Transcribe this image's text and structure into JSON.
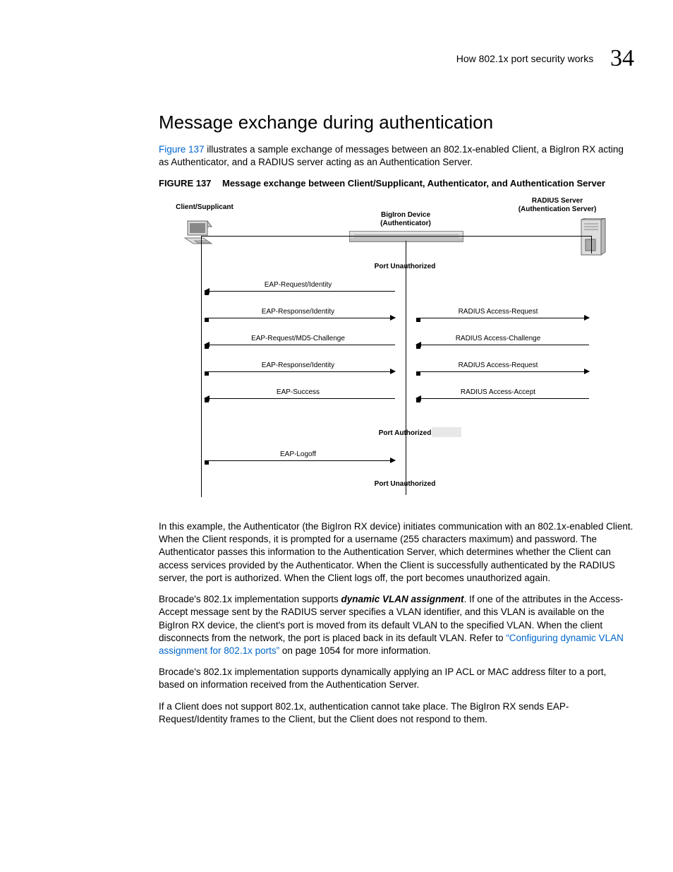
{
  "header": {
    "running_title": "How 802.1x port security works",
    "chapter_number": "34"
  },
  "section_title": "Message exchange during authentication",
  "intro": {
    "link": "Figure 137",
    "rest": " illustrates a sample exchange of messages between an 802.1x-enabled Client, a BigIron RX acting as Authenticator, and a RADIUS server acting as an Authentication Server."
  },
  "figure": {
    "label": "FIGURE 137",
    "caption": "Message exchange between Client/Supplicant, Authenticator, and Authentication Server"
  },
  "diagram": {
    "client_label": "Client/Supplicant",
    "device_label_l1": "BigIron Device",
    "device_label_l2": "(Authenticator)",
    "server_label_l1": "RADIUS Server",
    "server_label_l2": "(Authentication Server)",
    "state_unauth": "Port Unauthorized",
    "state_auth": "Port Authorized",
    "left_msgs": [
      "EAP-Request/Identity",
      "EAP-Response/Identity",
      "EAP-Request/MD5-Challenge",
      "EAP-Response/Identity",
      "EAP-Success",
      "EAP-Logoff"
    ],
    "right_msgs": [
      "RADIUS Access-Request",
      "RADIUS Access-Challenge",
      "RADIUS Access-Request",
      "RADIUS Access-Accept"
    ]
  },
  "para1": "In this example, the Authenticator (the BigIron RX device) initiates communication with an 802.1x-enabled Client. When the Client responds, it is prompted for a username (255 characters maximum) and password. The Authenticator passes this information to the Authentication Server, which determines whether the Client can access services provided by the Authenticator. When the Client is successfully authenticated by the RADIUS server, the port is authorized. When the Client logs off, the port becomes unauthorized again.",
  "para2": {
    "a": "Brocade's 802.1x implementation supports ",
    "em": "dynamic VLAN assignment",
    "b": ". If one of the attributes in the Access-Accept message sent by the RADIUS server specifies a VLAN identifier, and this VLAN is available on the BigIron RX device, the client's port is moved from its default VLAN to the specified VLAN. When the client disconnects from the network, the port is placed back in its default VLAN. Refer to ",
    "link": "“Configuring dynamic VLAN assignment for 802.1x ports”",
    "c": " on page 1054 for more information."
  },
  "para3": "Brocade's 802.1x implementation supports dynamically applying an IP ACL or MAC address filter to a port, based on information received from the Authentication Server.",
  "para4": "If a Client does not support 802.1x, authentication cannot take place. The BigIron RX sends EAP-Request/Identity frames to the Client, but the Client does not respond to them."
}
